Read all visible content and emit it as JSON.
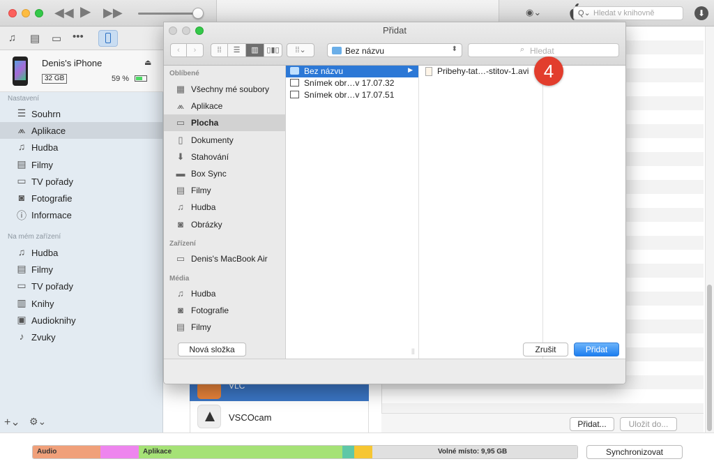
{
  "library_search": {
    "placeholder": "Hledat v knihovně"
  },
  "device": {
    "name": "Denis's iPhone",
    "capacity": "32 GB",
    "battery": "59 %"
  },
  "sidebar": {
    "settings_title": "Nastavení",
    "settings": [
      {
        "label": "Souhrn",
        "icon": "list-icon"
      },
      {
        "label": "Aplikace",
        "icon": "apps-icon"
      },
      {
        "label": "Hudba",
        "icon": "music-note-icon"
      },
      {
        "label": "Filmy",
        "icon": "film-icon"
      },
      {
        "label": "TV pořady",
        "icon": "tv-icon"
      },
      {
        "label": "Fotografie",
        "icon": "camera-icon"
      },
      {
        "label": "Informace",
        "icon": "info-icon"
      }
    ],
    "device_title": "Na mém zařízení",
    "on_device": [
      {
        "label": "Hudba",
        "icon": "music-note-icon"
      },
      {
        "label": "Filmy",
        "icon": "film-icon"
      },
      {
        "label": "TV pořady",
        "icon": "tv-icon"
      },
      {
        "label": "Knihy",
        "icon": "book-icon"
      },
      {
        "label": "Audioknihy",
        "icon": "audiobook-icon"
      },
      {
        "label": "Zvuky",
        "icon": "bell-icon"
      }
    ]
  },
  "apps_list": {
    "selected_partial": "VLC",
    "vsco": "VSCOcam"
  },
  "docs": {
    "add_button": "Přidat...",
    "save_button": "Uložit do..."
  },
  "capacity_bar": {
    "audio": "Audio",
    "apps": "Aplikace",
    "free": "Volné místo: 9,95 GB",
    "sync_button": "Synchronizovat",
    "colors": {
      "audio": "#f0a07a",
      "photos": "#ee85ee",
      "apps": "#a5e276",
      "teal": "#5fc7a7",
      "yellow": "#f6c632",
      "free": "#e0e0e0"
    }
  },
  "dialog": {
    "title": "Přidat",
    "path": "Bez názvu",
    "search_placeholder": "Hledat",
    "favorites_title": "Oblíbené",
    "favorites": [
      {
        "label": "Všechny mé soubory",
        "icon": "all-files-icon"
      },
      {
        "label": "Aplikace",
        "icon": "apps-icon"
      },
      {
        "label": "Plocha",
        "icon": "desktop-icon"
      },
      {
        "label": "Dokumenty",
        "icon": "document-icon"
      },
      {
        "label": "Stahování",
        "icon": "download-icon"
      },
      {
        "label": "Box Sync",
        "icon": "folder-icon"
      },
      {
        "label": "Filmy",
        "icon": "film-icon"
      },
      {
        "label": "Hudba",
        "icon": "music-note-icon"
      },
      {
        "label": "Obrázky",
        "icon": "camera-icon"
      }
    ],
    "devices_title": "Zařízení",
    "devices": [
      {
        "label": "Denis's MacBook Air",
        "icon": "laptop-icon"
      }
    ],
    "media_title": "Média",
    "media": [
      {
        "label": "Hudba",
        "icon": "music-note-icon"
      },
      {
        "label": "Fotografie",
        "icon": "camera-icon"
      },
      {
        "label": "Filmy",
        "icon": "film-icon"
      }
    ],
    "column1": [
      "Bez názvu",
      "Snímek obr…v 17.07.32",
      "Snímek obr…v 17.07.51"
    ],
    "column2": [
      "Pribehy-tat…-stitov-1.avi"
    ],
    "new_folder": "Nová složka",
    "cancel": "Zrušit",
    "add": "Přidat"
  },
  "step_badge": "4"
}
